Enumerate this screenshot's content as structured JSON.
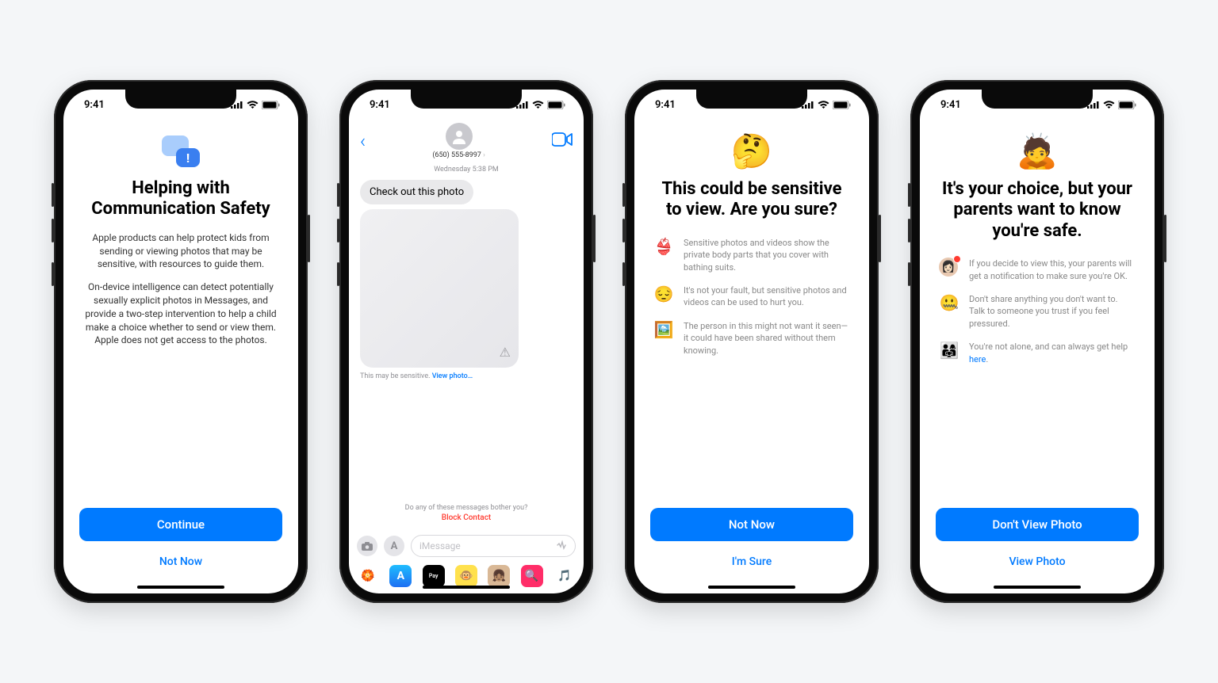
{
  "status": {
    "time": "9:41"
  },
  "phone1": {
    "title": "Helping with Communication Safety",
    "para1": "Apple products can help protect kids from sending or viewing photos that may be sensitive, with resources to guide them.",
    "para2": "On-device intelligence can detect potentially sexually explicit photos in Messages, and provide a two-step intervention to help a child make a choice whether to send or view them. Apple does not get access to the photos.",
    "primary": "Continue",
    "secondary": "Not Now"
  },
  "phone2": {
    "contact": "(650) 555-8997",
    "timestamp": "Wednesday 5:38 PM",
    "message": "Check out this photo",
    "caption_prefix": "This may be sensitive. ",
    "caption_link": "View photo…",
    "bother": "Do any of these messages bother you?",
    "block": "Block Contact",
    "placeholder": "iMessage"
  },
  "phone3": {
    "emoji": "🤔",
    "title": "This could be sensitive to view. Are you sure?",
    "bullets": [
      {
        "emoji": "👙",
        "text": "Sensitive photos and videos show the private body parts that you cover with bathing suits."
      },
      {
        "emoji": "😔",
        "text": "It's not your fault, but sensitive photos and videos can be used to hurt you."
      },
      {
        "emoji": "🖼️",
        "text": "The person in this might not want it seen—it could have been shared without them knowing."
      }
    ],
    "primary": "Not Now",
    "secondary": "I'm Sure"
  },
  "phone4": {
    "emoji": "🙇",
    "title": "It's your choice, but your parents want to know you're safe.",
    "bullets": [
      {
        "emoji": "avatar",
        "text": "If you decide to view this, your parents will get a notification to make sure you're OK.",
        "badge": true
      },
      {
        "emoji": "🤐",
        "text": "Don't share anything you don't want to. Talk to someone you trust if you feel pressured."
      },
      {
        "emoji": "👨‍👩‍👧",
        "text_prefix": "You're not alone, and can always get help ",
        "link": "here",
        "text_suffix": "."
      }
    ],
    "primary": "Don't View Photo",
    "secondary": "View Photo"
  }
}
